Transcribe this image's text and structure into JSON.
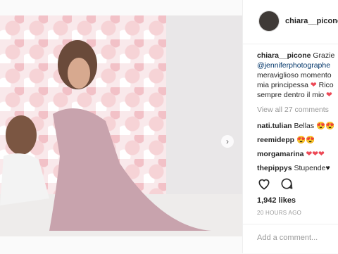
{
  "post": {
    "username": "chiara__picone",
    "caption_lines": [
      "Grazie",
      "@jenniferphotographe",
      "meraviglioso momento",
      "mia principessa",
      "sempre dentro il mio"
    ],
    "caption_emoji": "❤",
    "caption_tail_4": "Rico",
    "view_all": "View all 27 comments",
    "comments": [
      {
        "user": "nati.tulian",
        "text": "Bellas",
        "emoji": "😍😍"
      },
      {
        "user": "reemidepp",
        "text": "",
        "emoji": "😍😍"
      },
      {
        "user": "morgamarina",
        "text": "",
        "emoji": "❤❤❤"
      },
      {
        "user": "thepippys",
        "text": "Stupende",
        "emoji": "♥"
      }
    ],
    "likes": "1,942 likes",
    "time": "20 HOURS AGO",
    "add_comment_placeholder": "Add a comment..."
  },
  "icons": {
    "heart": "heart-outline-icon",
    "comment": "comment-bubble-icon",
    "next": "chevron-right-icon"
  },
  "colors": {
    "accent_link": "#003569",
    "heart": "#ed4956"
  }
}
